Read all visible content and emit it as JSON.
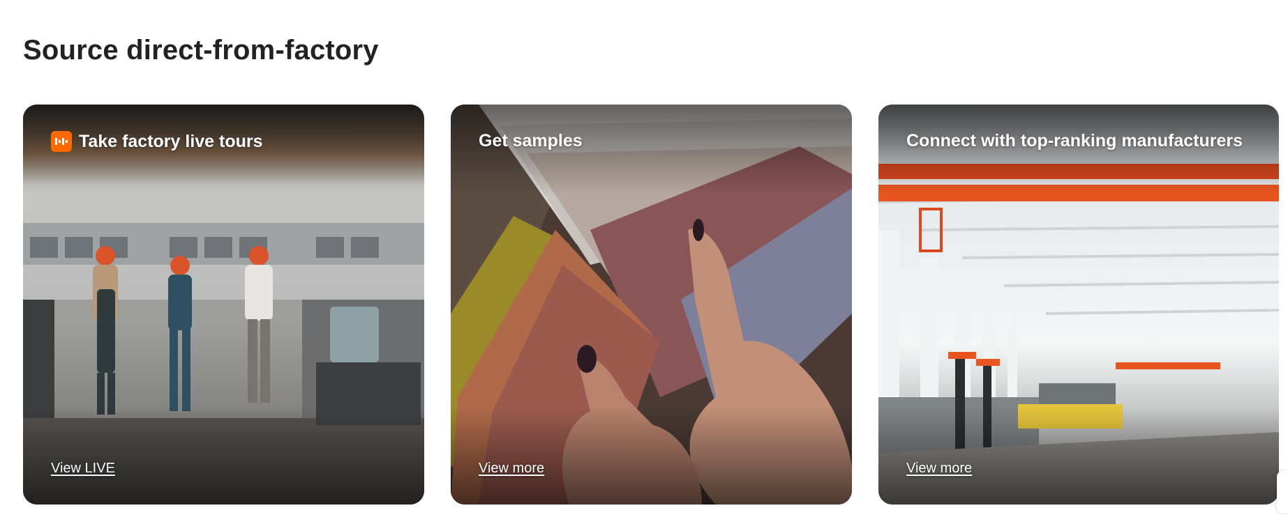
{
  "section": {
    "title": "Source direct-from-factory"
  },
  "cards": [
    {
      "title": "Take factory live tours",
      "link": "View LIVE",
      "icon": "live-icon"
    },
    {
      "title": "Get samples",
      "link": "View more"
    },
    {
      "title": "Connect with top-ranking manufacturers",
      "link": "View more"
    }
  ],
  "colors": {
    "accent": "#ff6a00",
    "title": "#222222"
  }
}
